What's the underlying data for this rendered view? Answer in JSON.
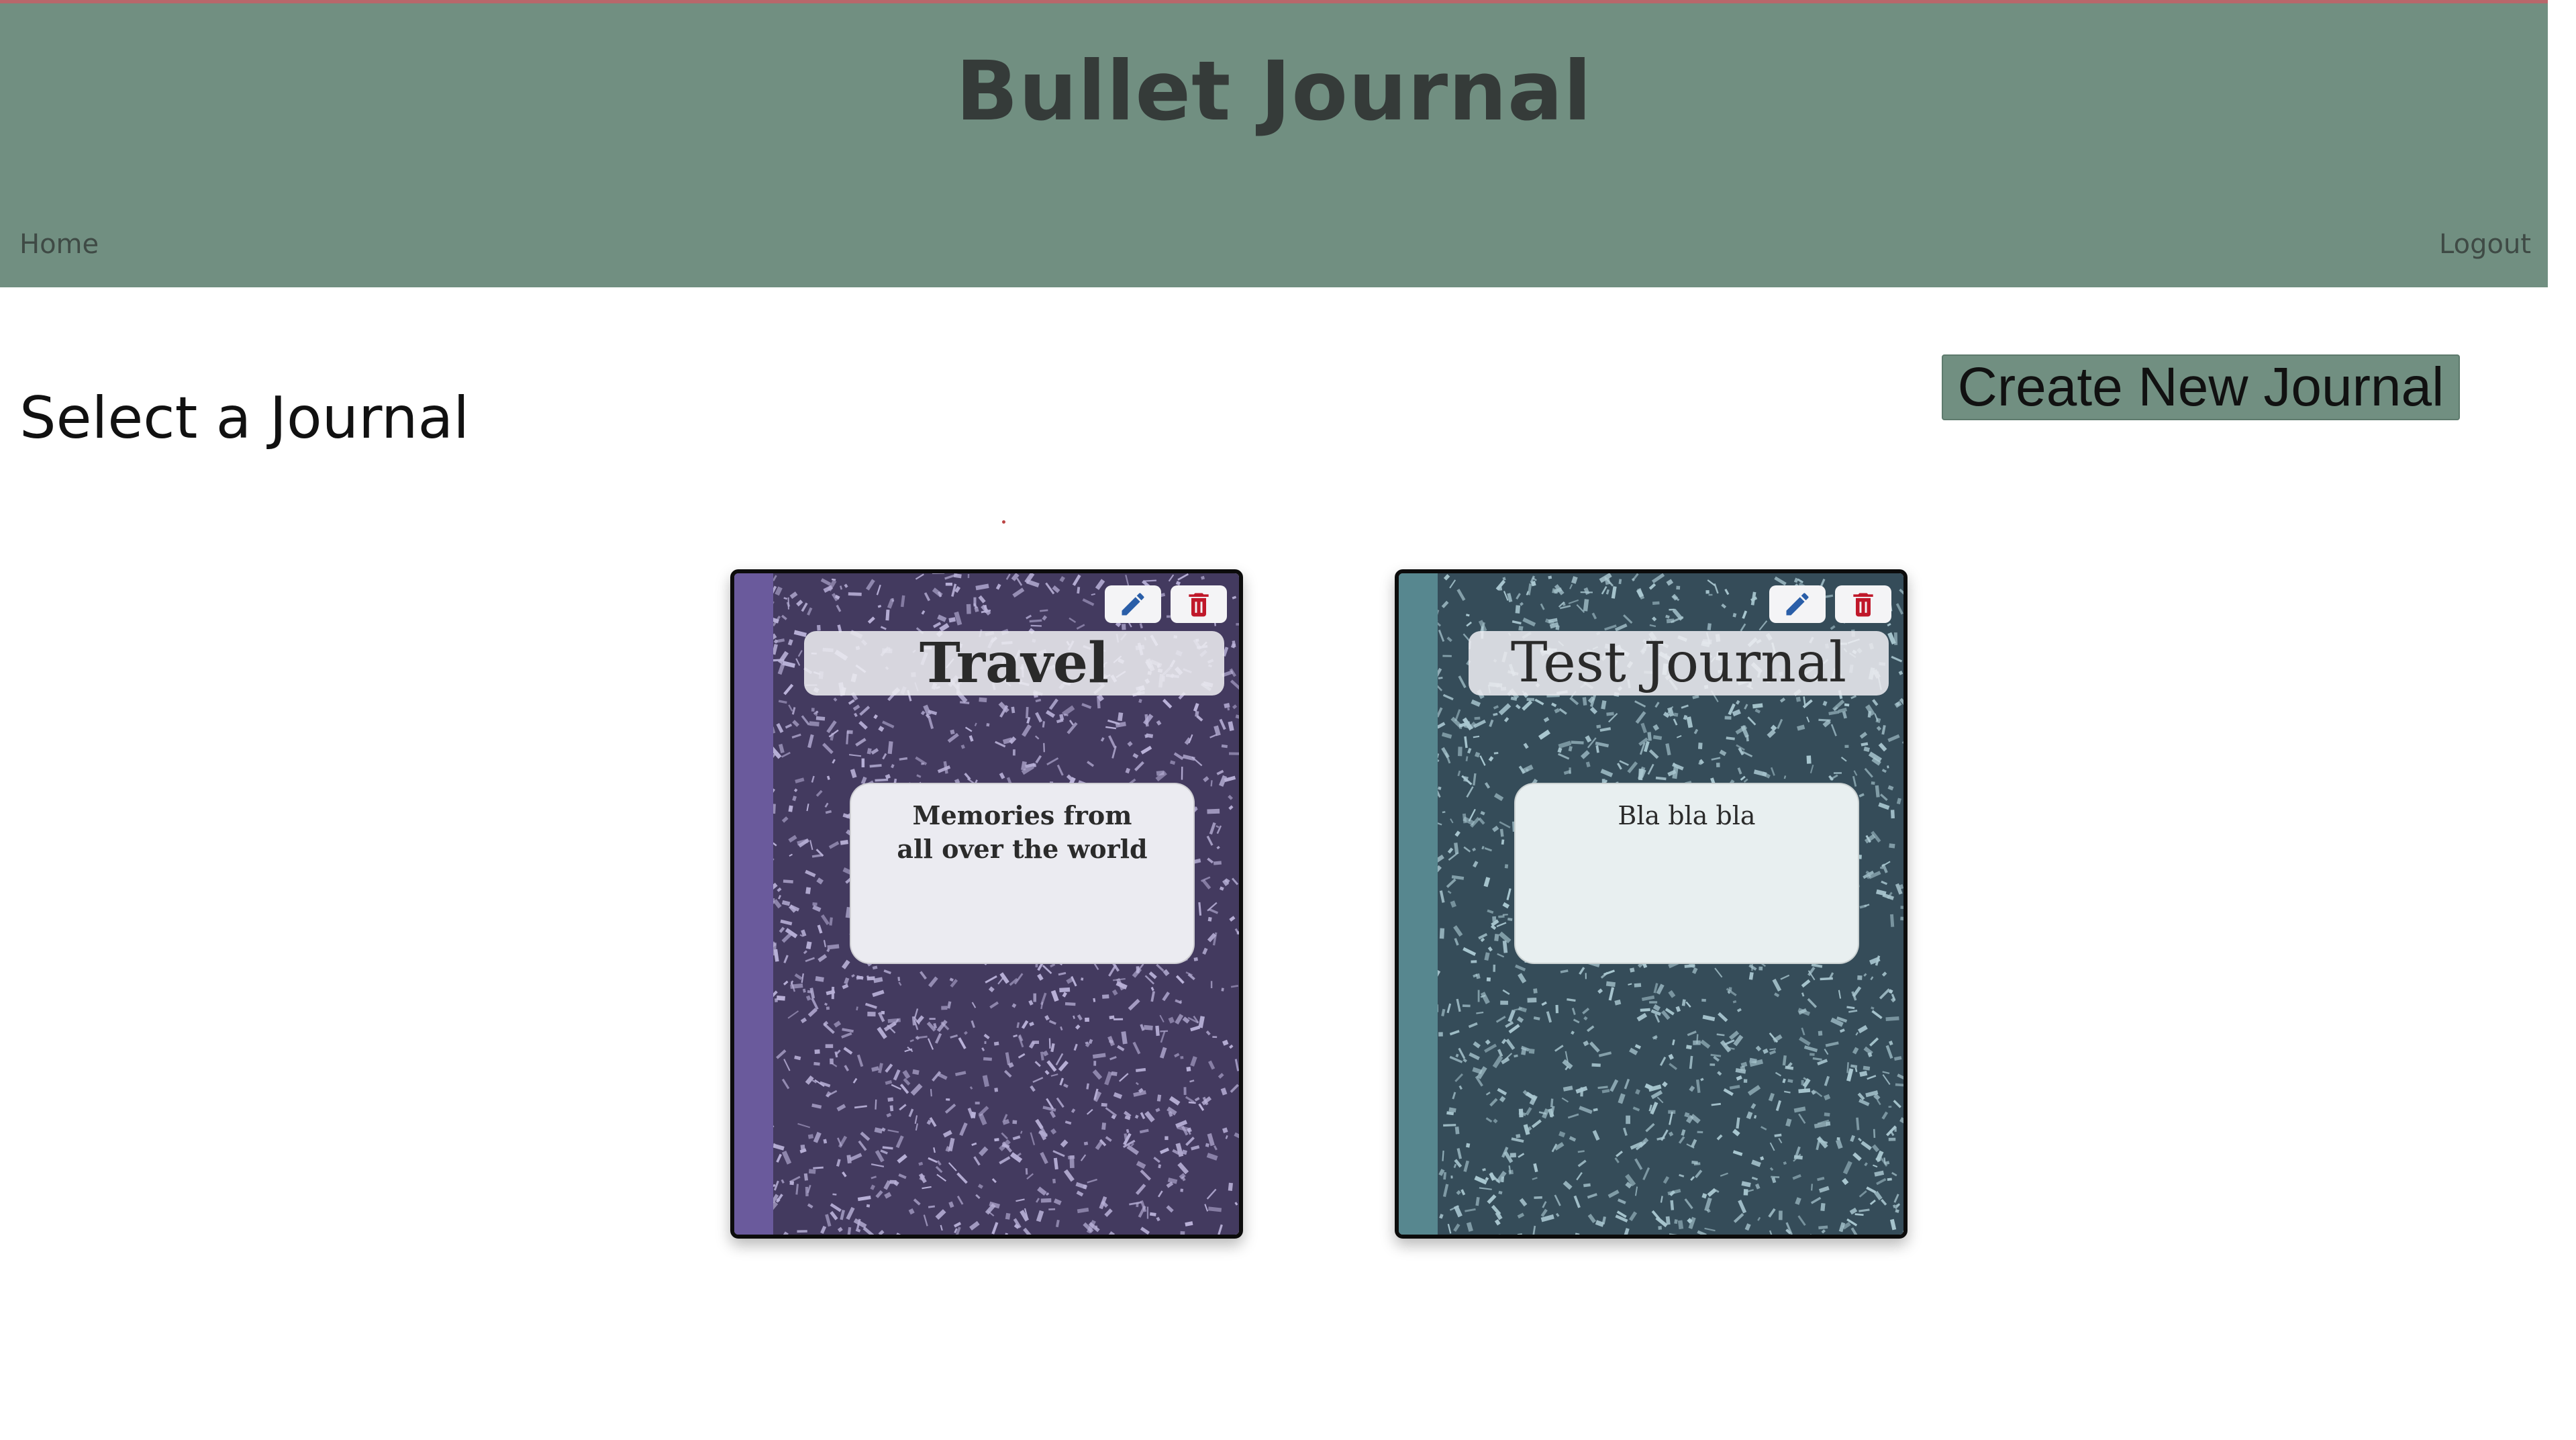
{
  "header": {
    "title": "Bullet Journal",
    "nav": {
      "home": "Home",
      "logout": "Logout"
    },
    "background": "#718f81"
  },
  "main": {
    "section_title": "Select a Journal",
    "create_button": "Create New Journal"
  },
  "journals": [
    {
      "title": "Travel",
      "description": "Memories from all over the world",
      "cover_color": "#433a5f",
      "speckle_color": "#b9b1d8",
      "spine_color": "#6a5a9c",
      "edit_icon": "pencil-icon",
      "delete_icon": "trash-icon"
    },
    {
      "title": "Test Journal",
      "description": "Bla bla bla",
      "cover_color": "#354c59",
      "speckle_color": "#a9c7d0",
      "spine_color": "#57878f",
      "edit_icon": "pencil-icon",
      "delete_icon": "trash-icon"
    }
  ],
  "colors": {
    "edit": "#2a5ea8",
    "delete": "#c0182a"
  }
}
